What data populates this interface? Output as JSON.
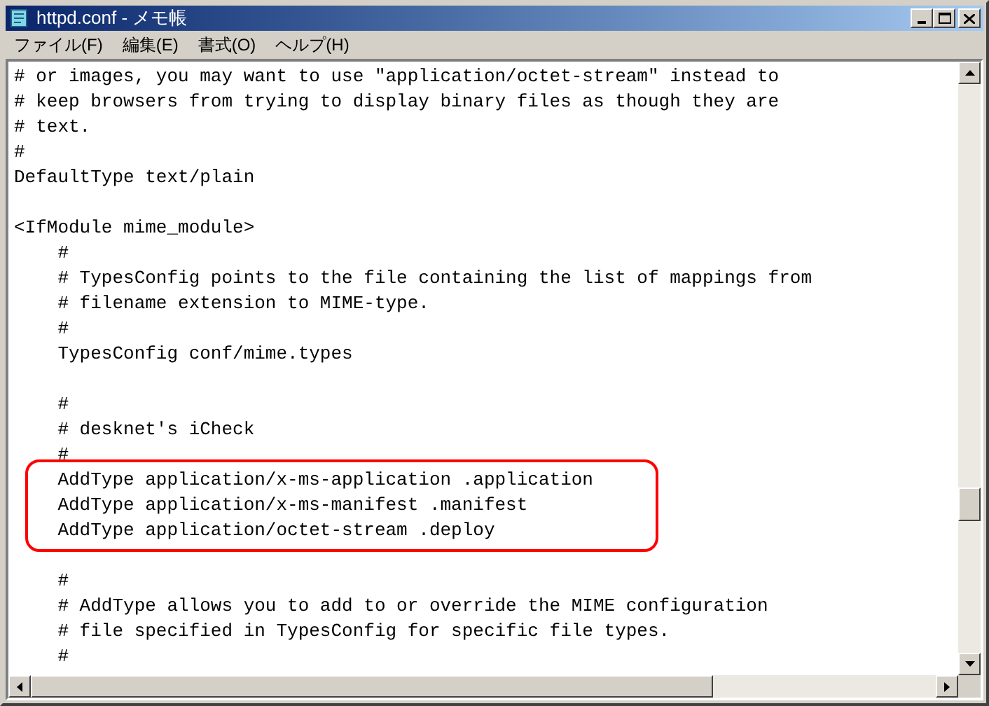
{
  "window": {
    "title": "httpd.conf - メモ帳"
  },
  "menu": [
    {
      "label": "ファイル(F)"
    },
    {
      "label": "編集(E)"
    },
    {
      "label": "書式(O)"
    },
    {
      "label": "ヘルプ(H)"
    }
  ],
  "lines": [
    {
      "kind": "text",
      "text": "# or images, you may want to use \"application/octet-stream\" instead to"
    },
    {
      "kind": "text",
      "text": "# keep browsers from trying to display binary files as though they are"
    },
    {
      "kind": "text",
      "text": "# text."
    },
    {
      "kind": "text",
      "text": "#"
    },
    {
      "kind": "text",
      "text": "DefaultType text/plain"
    },
    {
      "kind": "blank"
    },
    {
      "kind": "text",
      "text": "<IfModule mime_module>"
    },
    {
      "kind": "text",
      "text": "    #"
    },
    {
      "kind": "text",
      "text": "    # TypesConfig points to the file containing the list of mappings from"
    },
    {
      "kind": "text",
      "text": "    # filename extension to MIME-type."
    },
    {
      "kind": "text",
      "text": "    #"
    },
    {
      "kind": "text",
      "text": "    TypesConfig conf/mime.types"
    },
    {
      "kind": "blank"
    },
    {
      "kind": "text",
      "text": "    #"
    },
    {
      "kind": "text",
      "text": "    # desknet's iCheck"
    },
    {
      "kind": "text",
      "text": "    #"
    },
    {
      "kind": "text",
      "text": "    AddType application/x-ms-application .application",
      "highlighted": true
    },
    {
      "kind": "text",
      "text": "    AddType application/x-ms-manifest .manifest",
      "highlighted": true
    },
    {
      "kind": "text",
      "text": "    AddType application/octet-stream .deploy",
      "highlighted": true
    },
    {
      "kind": "blank"
    },
    {
      "kind": "text",
      "text": "    #"
    },
    {
      "kind": "text",
      "text": "    # AddType allows you to add to or override the MIME configuration"
    },
    {
      "kind": "text",
      "text": "    # file specified in TypesConfig for specific file types."
    },
    {
      "kind": "text",
      "text": "    #"
    }
  ]
}
